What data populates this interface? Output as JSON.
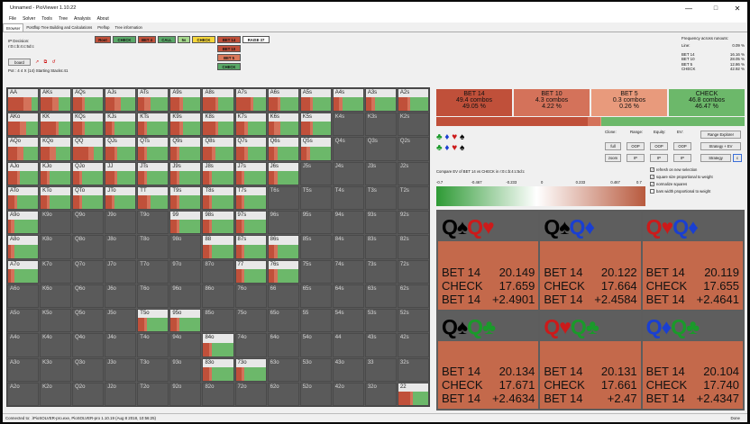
{
  "window": {
    "title": "Unnamed - PioViewer 1.10.22"
  },
  "menu": [
    "File",
    "Solver",
    "Tools",
    "Tree",
    "Analysis",
    "About"
  ],
  "tabs": [
    "Browser",
    "Postflop Tree Building and Calculations",
    "Preflop",
    "Tree information"
  ],
  "ip_decision": {
    "label": "IP Decision:",
    "path": "r:0:c:b:4:c:5d:c",
    "board_button": "board",
    "pot_info": "Pot : 4 4 X (14) Starting Stacks:41"
  },
  "actions": [
    {
      "label": "Root",
      "color": "#c0503a"
    },
    {
      "label": "CHECK",
      "color": "#5aa868"
    },
    {
      "label": "BET 4",
      "color": "#c0503a"
    },
    {
      "label": "CALL",
      "color": "#5aa868"
    },
    {
      "label": "5s",
      "color": "#a6d98c"
    },
    {
      "label": "CHECK",
      "color": "#f5d63a"
    },
    {
      "label": "BET 14",
      "color": "#c0503a"
    },
    {
      "label": "RAISE 37",
      "color": "#ffffff"
    },
    {
      "label": "BET 10",
      "color": "#c0503a"
    },
    {
      "label": "BET 5",
      "color": "#d9785a"
    },
    {
      "label": "CHECK",
      "color": "#5aa868"
    }
  ],
  "frequencies": {
    "title": "Frequency across runouts:",
    "line_label": "Line:",
    "line_value": "0.09 %",
    "rows": [
      {
        "k": "BET 14",
        "v": "16.16 %"
      },
      {
        "k": "BET 10",
        "v": "28.05 %"
      },
      {
        "k": "BET 5",
        "v": "12.86 %"
      },
      {
        "k": "CHECK",
        "v": "42.92 %"
      }
    ]
  },
  "hands": [
    "AA",
    "AKs",
    "AQs",
    "AJs",
    "ATs",
    "A9s",
    "A8s",
    "A7s",
    "A6s",
    "A5s",
    "A4s",
    "A3s",
    "A2s",
    "AKo",
    "KK",
    "KQs",
    "KJs",
    "KTs",
    "K9s",
    "K8s",
    "K7s",
    "K6s",
    "K5s",
    "K4s",
    "K3s",
    "K2s",
    "AQo",
    "KQo",
    "QQ",
    "QJs",
    "QTs",
    "Q9s",
    "Q8s",
    "Q7s",
    "Q6s",
    "Q5s",
    "Q4s",
    "Q3s",
    "Q2s",
    "AJo",
    "KJo",
    "QJo",
    "JJ",
    "JTs",
    "J9s",
    "J8s",
    "J7s",
    "J6s",
    "J5s",
    "J4s",
    "J3s",
    "J2s",
    "ATo",
    "KTo",
    "QTo",
    "JTo",
    "TT",
    "T9s",
    "T8s",
    "T7s",
    "T6s",
    "T5s",
    "T4s",
    "T3s",
    "T2s",
    "A9o",
    "K9o",
    "Q9o",
    "J9o",
    "T9o",
    "99",
    "98s",
    "97s",
    "96s",
    "95s",
    "94s",
    "93s",
    "92s",
    "A8o",
    "K8o",
    "Q8o",
    "J8o",
    "T8o",
    "98o",
    "88",
    "87s",
    "86s",
    "85s",
    "84s",
    "83s",
    "82s",
    "A7o",
    "K7o",
    "Q7o",
    "J7o",
    "T7o",
    "97o",
    "87o",
    "77",
    "76s",
    "75s",
    "74s",
    "73s",
    "72s",
    "A6o",
    "K6o",
    "Q6o",
    "J6o",
    "T6o",
    "96o",
    "86o",
    "76o",
    "66",
    "65s",
    "64s",
    "63s",
    "62s",
    "A5o",
    "K5o",
    "Q5o",
    "J5o",
    "T5o",
    "95o",
    "85o",
    "75o",
    "65o",
    "55",
    "54s",
    "53s",
    "52s",
    "A4o",
    "K4o",
    "Q4o",
    "J4o",
    "T4o",
    "94o",
    "84o",
    "74o",
    "64o",
    "54o",
    "44",
    "43s",
    "42s",
    "A3o",
    "K3o",
    "Q3o",
    "J3o",
    "T3o",
    "93o",
    "83o",
    "73o",
    "63o",
    "53o",
    "43o",
    "33",
    "32s",
    "A2o",
    "K2o",
    "Q2o",
    "J2o",
    "T2o",
    "92o",
    "82o",
    "72o",
    "62o",
    "52o",
    "42o",
    "32o",
    "22"
  ],
  "aggregate": [
    {
      "name": "BET 14",
      "combos": "49.4 combos",
      "pct": "49.05 %",
      "color": "#c0503a"
    },
    {
      "name": "BET 10",
      "combos": "4.3 combos",
      "pct": "4.22 %",
      "color": "#d4725a"
    },
    {
      "name": "BET 5",
      "combos": "0.3 combos",
      "pct": "0.26 %",
      "color": "#e89a7c"
    },
    {
      "name": "CHECK",
      "combos": "46.8 combos",
      "pct": "46.47 %",
      "color": "#6cb86a"
    }
  ],
  "suits": {
    "row1": [
      "♣",
      "♦",
      "♥",
      "♠"
    ],
    "row2": [
      "♣",
      "♦",
      "♥",
      "♠"
    ]
  },
  "options": {
    "labels": [
      "Clone:",
      "Range:",
      "Equity:",
      "EV:"
    ],
    "buttons": [
      "full",
      "OOP",
      "OOP",
      "OOP",
      "zoom",
      "IP",
      "IP",
      "IP"
    ],
    "range_explorer": "Range Explorer",
    "strategy_ev": "Strategy + EV",
    "strategy": "Strategy",
    "c_btn": "c"
  },
  "compare": "Compare EV of BET 14 vs CHECK in r:0:c:b:4:c:5d:c",
  "scale": [
    "-0.7",
    "-0.467",
    "-0.233",
    "0",
    "0.233",
    "0.467",
    "0.7"
  ],
  "checks": [
    {
      "label": "refresh on new selection",
      "on": true
    },
    {
      "label": "square size proportional to weight",
      "on": true
    },
    {
      "label": "normalize squares",
      "on": true
    },
    {
      "label": "bars width proportional to weight",
      "on": false
    }
  ],
  "combos": [
    {
      "c1": "Q♠",
      "c2": "Q♥",
      "c1col": "#000",
      "c2col": "#cc1a1a",
      "r": [
        [
          "BET 14",
          "20.149"
        ],
        [
          "CHECK",
          "17.659"
        ],
        [
          "BET 14",
          "+2.4901"
        ]
      ]
    },
    {
      "c1": "Q♠",
      "c2": "Q♦",
      "c1col": "#000",
      "c2col": "#1a3fd1",
      "r": [
        [
          "BET 14",
          "20.122"
        ],
        [
          "CHECK",
          "17.664"
        ],
        [
          "BET 14",
          "+2.4584"
        ]
      ]
    },
    {
      "c1": "Q♥",
      "c2": "Q♦",
      "c1col": "#cc1a1a",
      "c2col": "#1a3fd1",
      "r": [
        [
          "BET 14",
          "20.119"
        ],
        [
          "CHECK",
          "17.655"
        ],
        [
          "BET 14",
          "+2.4641"
        ]
      ]
    },
    {
      "c1": "Q♠",
      "c2": "Q♣",
      "c1col": "#000",
      "c2col": "#1a9a2a",
      "r": [
        [
          "BET 14",
          "20.134"
        ],
        [
          "CHECK",
          "17.671"
        ],
        [
          "BET 14",
          "+2.4634"
        ]
      ]
    },
    {
      "c1": "Q♥",
      "c2": "Q♣",
      "c1col": "#cc1a1a",
      "c2col": "#1a9a2a",
      "r": [
        [
          "BET 14",
          "20.131"
        ],
        [
          "CHECK",
          "17.661"
        ],
        [
          "BET 14",
          "+2.47"
        ]
      ]
    },
    {
      "c1": "Q♦",
      "c2": "Q♣",
      "c1col": "#1a3fd1",
      "c2col": "#1a9a2a",
      "r": [
        [
          "BET 14",
          "20.104"
        ],
        [
          "CHECK",
          "17.740"
        ],
        [
          "BET 14",
          "+2.4347"
        ]
      ]
    }
  ],
  "status": {
    "left": "Connected to: .\\PioSOLVER-pro.exe, PioSOLVER-pro 1.10.19 (Aug 8 2018, 10:56:25)",
    "right": "Done"
  }
}
